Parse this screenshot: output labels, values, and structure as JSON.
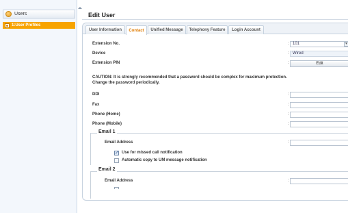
{
  "sidebar": {
    "header_label": "Users",
    "items": [
      {
        "label": "1:User Profiles"
      }
    ]
  },
  "page_title": "Edit User",
  "tabs": [
    {
      "label": "User Information",
      "active": false
    },
    {
      "label": "Contact",
      "active": true
    },
    {
      "label": "Unified Message",
      "active": false
    },
    {
      "label": "Telephony Feature",
      "active": false
    },
    {
      "label": "Login Account",
      "active": false
    }
  ],
  "form": {
    "extension_no": {
      "label": "Extension No.",
      "value": "101"
    },
    "device": {
      "label": "Device",
      "value": "Wired"
    },
    "extension_pin": {
      "label": "Extension PIN",
      "button_label": "Edit"
    },
    "caution_text": "CAUTION: It is strongly recommended that a password should be complex for maximum protection. Change the password periodically.",
    "ddi": {
      "label": "DDI",
      "value": ""
    },
    "fax": {
      "label": "Fax",
      "value": ""
    },
    "phone_home": {
      "label": "Phone (Home)",
      "value": ""
    },
    "phone_mobile": {
      "label": "Phone (Mobile)",
      "value": ""
    },
    "colon": ":"
  },
  "email1": {
    "legend": "Email 1",
    "address_label": "Email Address",
    "address_value": "",
    "missed_call_label": "Use for missed call notification",
    "missed_call_checked": true,
    "um_copy_label": "Automatic copy to UM message notification",
    "um_copy_checked": false
  },
  "email2": {
    "legend": "Email 2",
    "address_label": "Email Address",
    "address_value": ""
  }
}
